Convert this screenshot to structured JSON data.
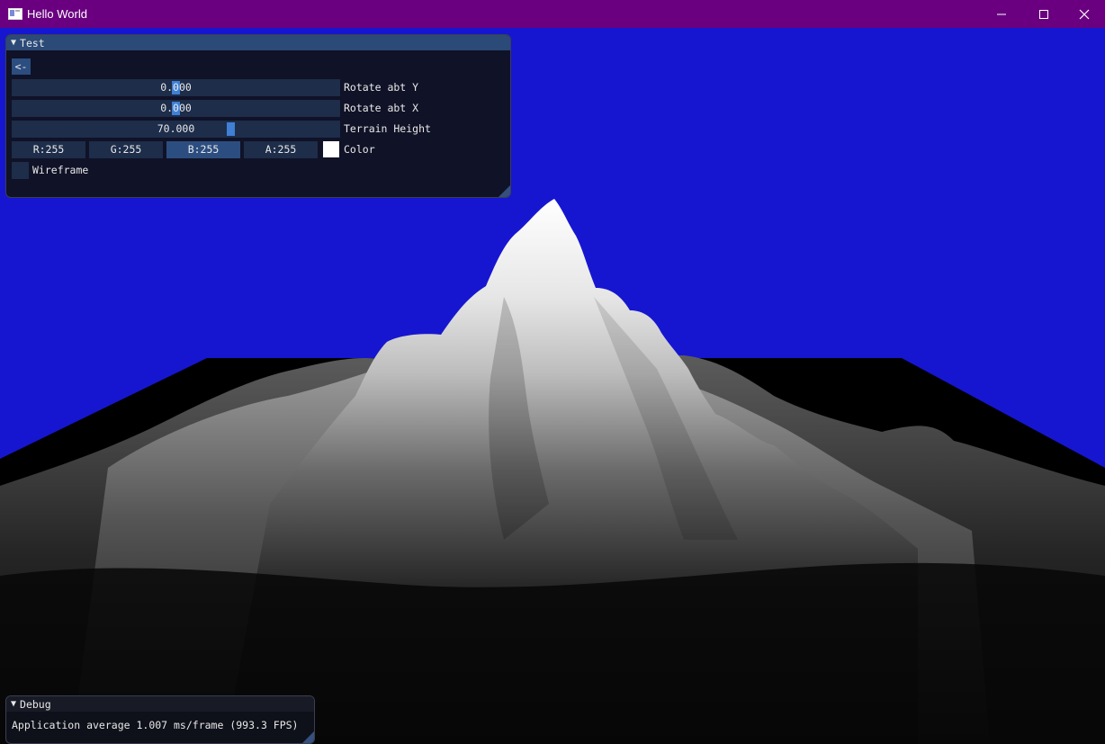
{
  "window": {
    "title": "Hello World",
    "icon": "app-window-icon",
    "controls": [
      "minimize-icon",
      "maximize-icon",
      "close-icon"
    ]
  },
  "colors": {
    "titlebar": "#6a0080",
    "sky": "#1616d0",
    "terrain": "#ffffff",
    "panel_header": "#2b4a78",
    "widget_bg": "#1d2d4a",
    "accent": "#3f7fd4"
  },
  "test_panel": {
    "title": "Test",
    "back_button": "<-",
    "rotate_y": {
      "value": "0.000",
      "label": "Rotate abt Y"
    },
    "rotate_x": {
      "value": "0.000",
      "label": "Rotate abt X"
    },
    "terrain_height": {
      "value": "70.000",
      "label": "Terrain Height"
    },
    "color": {
      "r": "R:255",
      "g": "G:255",
      "b": "B:255",
      "a": "A:255",
      "label": "Color",
      "swatch": "#ffffff"
    },
    "wireframe": {
      "label": "Wireframe",
      "checked": false
    }
  },
  "debug_panel": {
    "title": "Debug",
    "text": "Application average 1.007 ms/frame (993.3 FPS)"
  }
}
